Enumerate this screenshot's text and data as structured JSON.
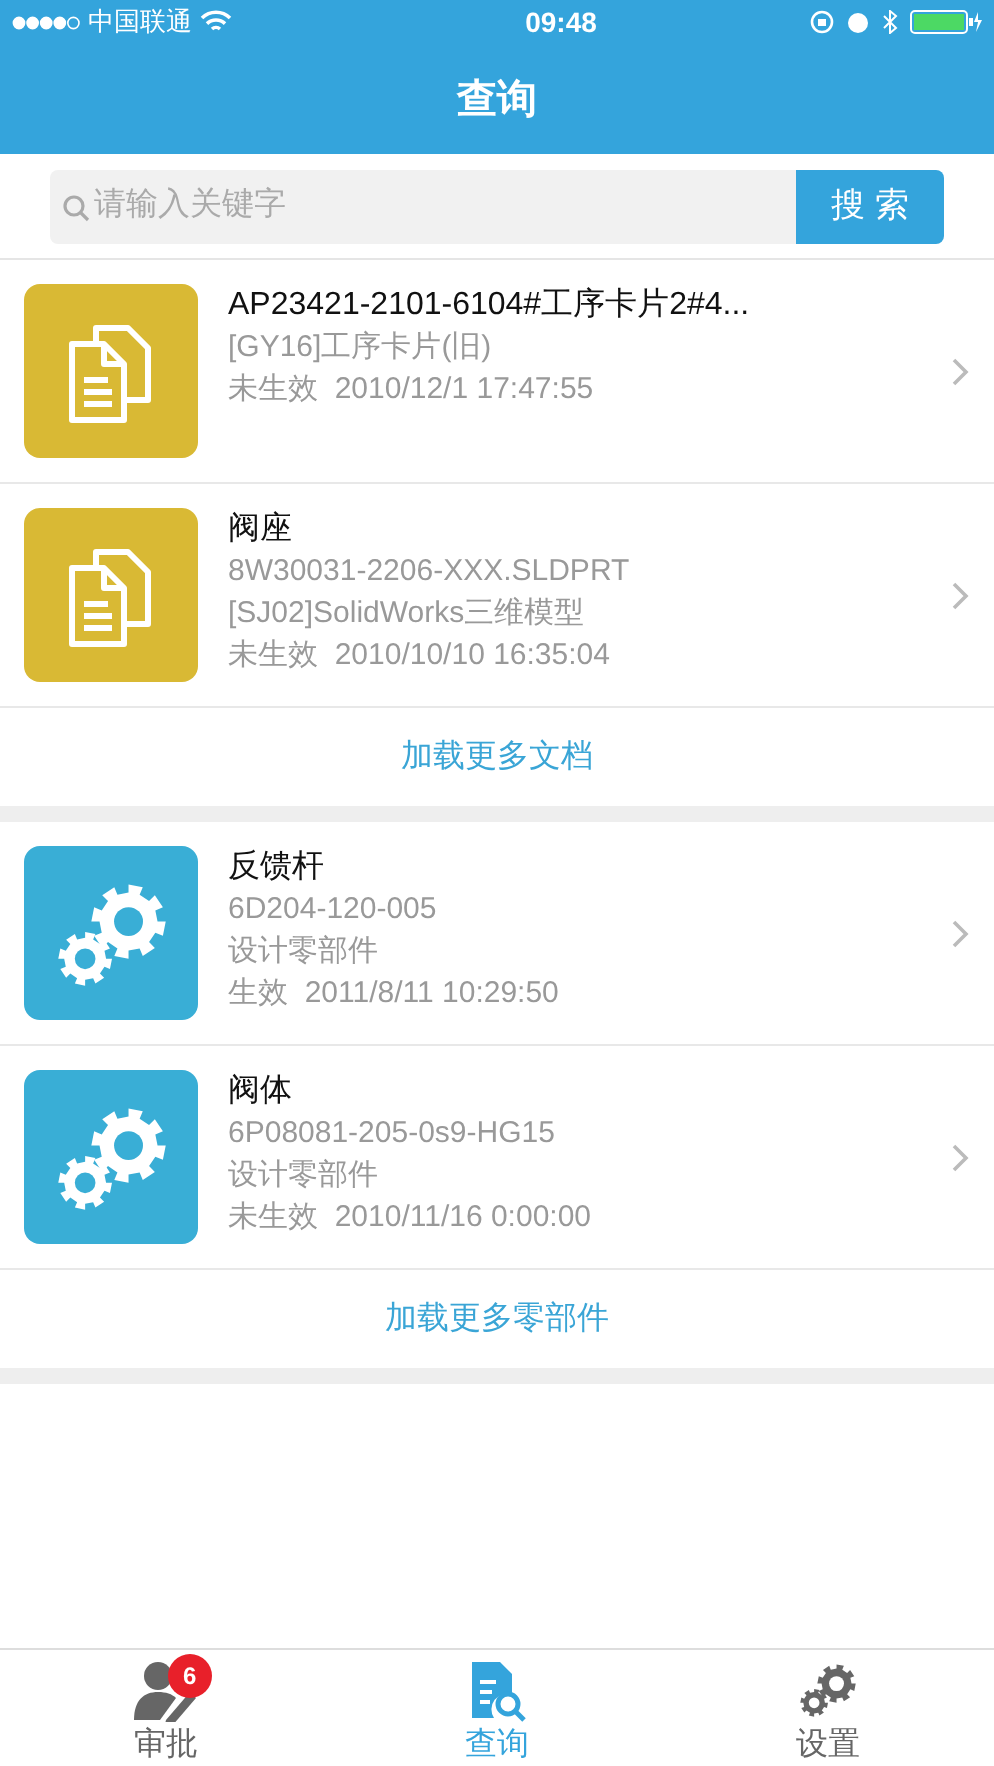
{
  "status_bar": {
    "carrier": "中国联通",
    "time": "09:48"
  },
  "nav": {
    "title": "查询"
  },
  "search": {
    "placeholder": "请输入关键字",
    "button": "搜 索"
  },
  "sections": [
    {
      "kind": "document",
      "items": [
        {
          "title": "AP23421-2101-6104#工序卡片2#4...",
          "lines": [
            "[GY16]工序卡片(旧)",
            "未生效  2010/12/1 17:47:55"
          ]
        },
        {
          "title": "阀座",
          "lines": [
            "8W30031-2206-XXX.SLDPRT",
            "[SJ02]SolidWorks三维模型",
            "未生效  2010/10/10 16:35:04"
          ]
        }
      ],
      "load_more": "加载更多文档"
    },
    {
      "kind": "part",
      "items": [
        {
          "title": "反馈杆",
          "lines": [
            "6D204-120-005",
            "设计零部件",
            "生效  2011/8/11 10:29:50"
          ]
        },
        {
          "title": "阀体",
          "lines": [
            "6P08081-205-0s9-HG15",
            "设计零部件",
            "未生效  2010/11/16 0:00:00"
          ]
        }
      ],
      "load_more": "加载更多零部件"
    }
  ],
  "tabs": [
    {
      "kind": "approve",
      "label": "审批",
      "selected": false,
      "badge": "6"
    },
    {
      "kind": "search",
      "label": "查询",
      "selected": true
    },
    {
      "kind": "settings",
      "label": "设置",
      "selected": false
    }
  ]
}
